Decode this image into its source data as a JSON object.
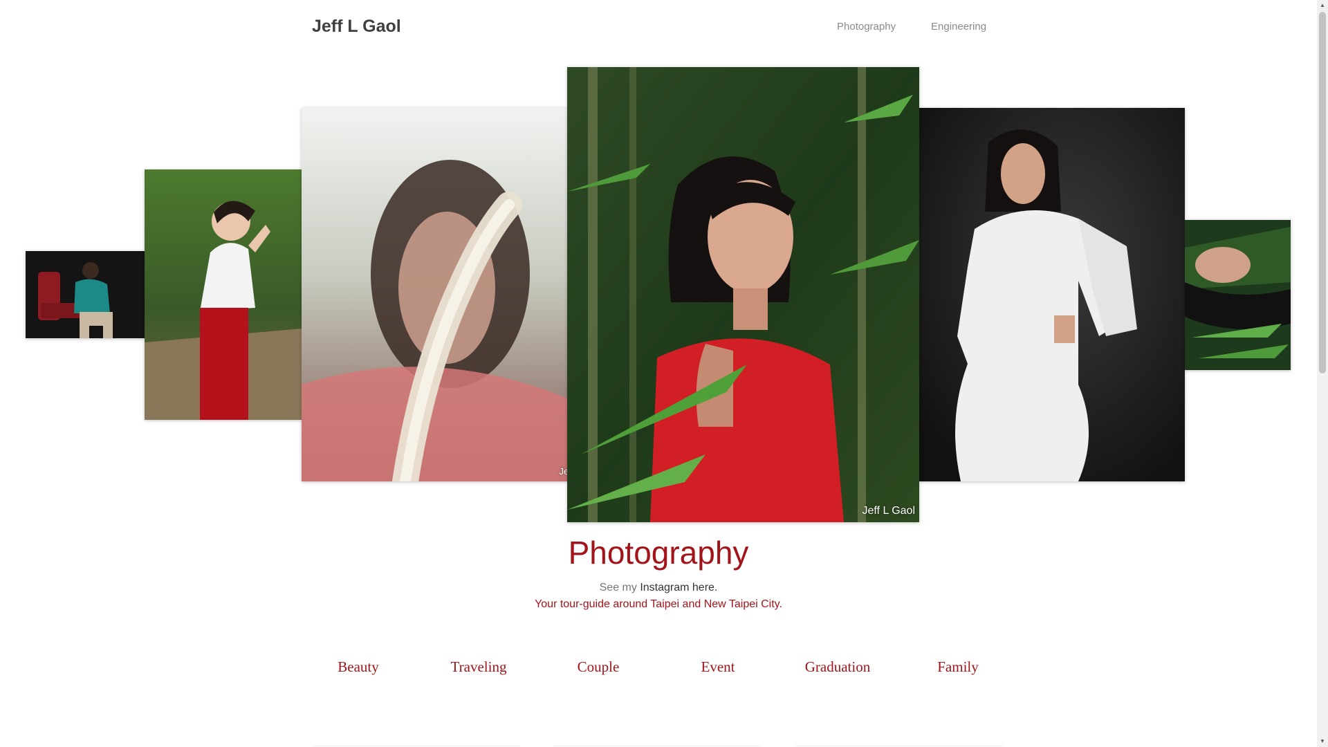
{
  "header": {
    "brand": "Jeff L Gaol",
    "nav": [
      "Photography",
      "Engineering"
    ]
  },
  "carousel": {
    "watermark": "Jeff L Gaol",
    "watermark_partial": "Jeff L"
  },
  "section": {
    "title": "Photography",
    "see_prefix": "See my ",
    "instagram_link": "Instagram here.",
    "tagline": "Your tour-guide around Taipei and New Taipei City."
  },
  "categories": [
    "Beauty",
    "Traveling",
    "Couple",
    "Event",
    "Graduation",
    "Family"
  ],
  "colors": {
    "accent": "#a3141a",
    "brand_text": "#3f3f3f",
    "nav_text": "#8a8a8a"
  },
  "icons": {
    "scroll_up": "▲",
    "scroll_down": "▼"
  }
}
